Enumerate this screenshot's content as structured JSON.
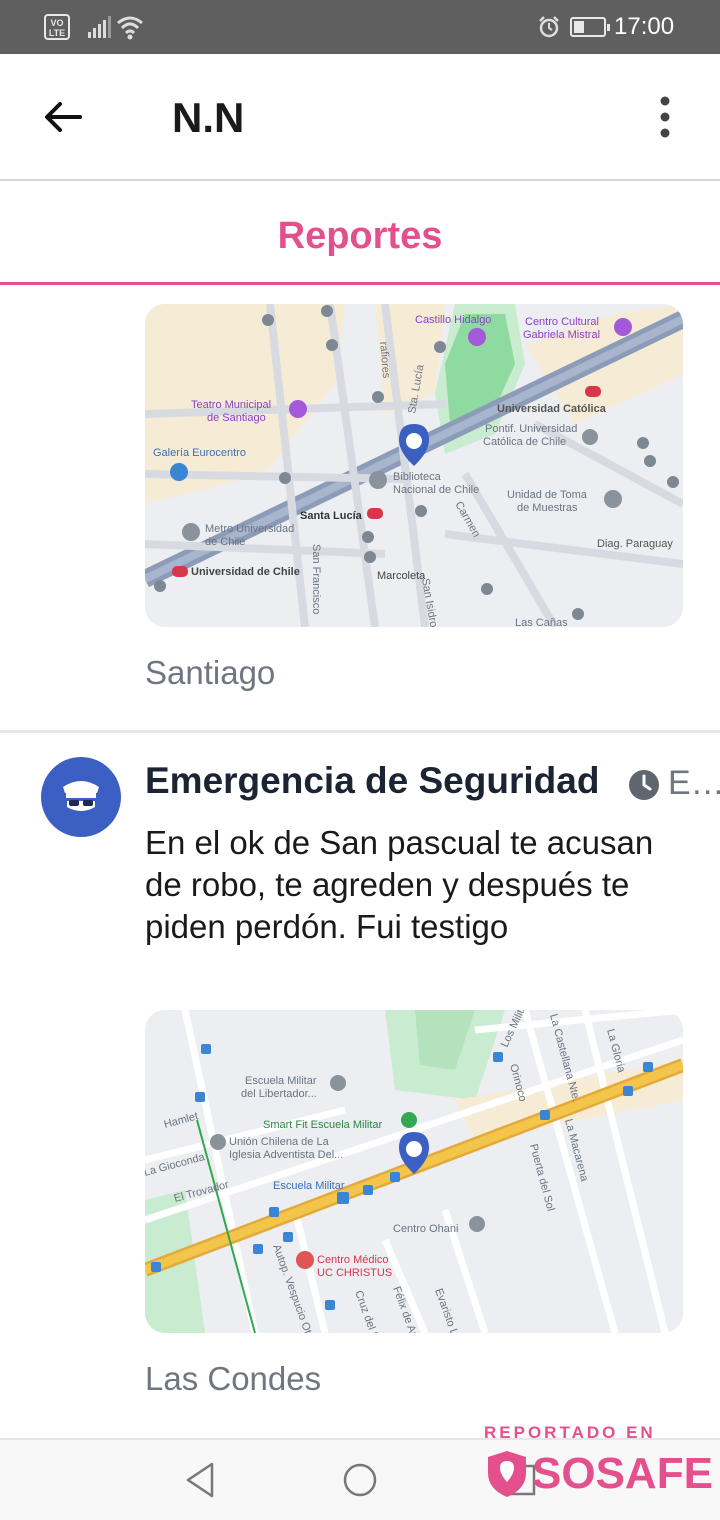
{
  "status_bar": {
    "network": "VO LTE",
    "time": "17:00"
  },
  "app_bar": {
    "title": "N.N"
  },
  "tabs": {
    "active": "Reportes"
  },
  "reports": [
    {
      "location": "Santiago",
      "map_labels": [
        "Castillo Hidalgo",
        "Centro Cultural",
        "Gabriela Mistral",
        "Teatro Municipal",
        "de Santiago",
        "Galería Eurocentro",
        "Universidad Católica",
        "Pontif. Universidad",
        "Católica de Chile",
        "Biblioteca",
        "Nacional de Chile",
        "Unidad de Toma",
        "de Muestras",
        "Santa Lucía",
        "Metro Universidad",
        "de Chile",
        "Universidad de Chile",
        "Marcoleta",
        "Diag. Paraguay",
        "Carmen",
        "Sta. Lucía",
        "rafiores",
        "San Francisco",
        "San Isidro",
        "Las Cañas"
      ]
    },
    {
      "title": "Emergencia de Seguridad",
      "time": "E…",
      "body": "En el ok de San pascual te acusan de robo, te agreden y después te piden perdón. Fui testigo",
      "location": "Las Condes",
      "map_labels": [
        "Escuela Militar",
        "del Libertador...",
        "Smart Fit Escuela Militar",
        "Unión Chilena de La",
        "Iglesia Adventista Del...",
        "Escuela Militar",
        "Centro Ohani",
        "Centro Médico",
        "UC CHRISTUS",
        "Hamlet",
        "La Gioconda",
        "El Trovador",
        "Autop. Vespucio Ote",
        "Cruz del S",
        "Félix de Am",
        "Evaristo L",
        "Los Militares",
        "La Castellana Nte.",
        "La Gloria",
        "Orinoco",
        "Puerta del Sol",
        "La Macarena"
      ]
    }
  ],
  "branding": {
    "reported_in": "REPORTADO EN",
    "name": "SOSAFE"
  },
  "colors": {
    "accent": "#e4508d",
    "avatar": "#3b5fc2",
    "highway": "#f3c54a"
  }
}
